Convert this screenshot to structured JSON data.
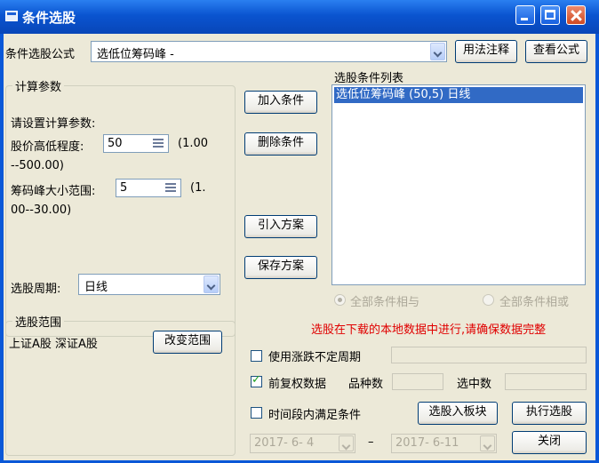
{
  "window": {
    "title": "条件选股"
  },
  "formula": {
    "label": "条件选股公式",
    "selected": "选低位筹码峰 -",
    "usage_button": "用法注释",
    "view_button": "查看公式"
  },
  "params": {
    "legend": "计算参数",
    "prompt": "请设置计算参数:",
    "p1": {
      "label": "股价高低程度:",
      "value": "50",
      "range_a": "(1.00",
      "range_b": "--500.00)"
    },
    "p2": {
      "label": "筹码峰大小范围:",
      "value": "5",
      "range_a": "(1.",
      "range_b": "00--30.00)"
    },
    "period_label": "选股周期:",
    "period_value": "日线"
  },
  "scope": {
    "legend": "选股范围",
    "value": "上证A股 深证A股",
    "change_button": "改变范围"
  },
  "actions": {
    "add": "加入条件",
    "delete": "删除条件",
    "import": "引入方案",
    "save": "保存方案"
  },
  "conditions": {
    "title": "选股条件列表",
    "items": [
      "选低位筹码峰 (50,5) 日线"
    ],
    "radio_and": "全部条件相与",
    "radio_or": "全部条件相或"
  },
  "notice": "选股在下载的本地数据中进行,请确保数据完整",
  "options": {
    "uncertain_period": "使用涨跌不定周期",
    "adjusted_data": "前复权数据",
    "count_label": "品种数",
    "selected_label": "选中数",
    "time_range": "时间段内满足条件",
    "date_from": "2017- 6- 4",
    "date_sep": "–",
    "date_to": "2017- 6-11"
  },
  "bottom": {
    "to_block": "选股入板块",
    "execute": "执行选股",
    "close": "关闭"
  }
}
